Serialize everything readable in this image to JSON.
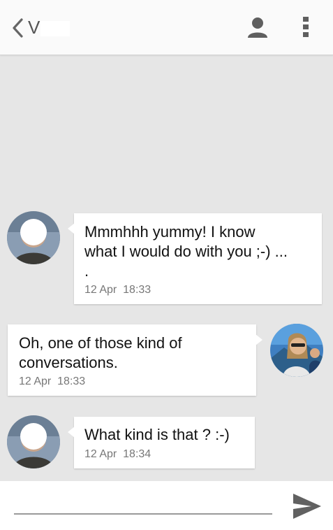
{
  "header": {
    "back_icon": "chevron-left-icon",
    "title": "V",
    "profile_icon": "person-icon",
    "menu_icon": "more-vert-icon"
  },
  "messages": [
    {
      "side": "incoming",
      "text_lines": [
        "Mmmhhh yummy! I know",
        "what I would do with you ;-) ...",
        "."
      ],
      "date": "12 Apr",
      "time": "18:33"
    },
    {
      "side": "outgoing",
      "text_lines": [
        "Oh, one of those kind of",
        "conversations."
      ],
      "date": "12 Apr",
      "time": "18:33"
    },
    {
      "side": "incoming",
      "text_lines": [
        "What kind is that ? :-)"
      ],
      "date": "12 Apr",
      "time": "18:34"
    }
  ],
  "composer": {
    "value": "",
    "placeholder": "",
    "send_icon": "send-icon"
  },
  "colors": {
    "background": "#e6e6e6",
    "app_bar": "#fafafa",
    "bubble": "#ffffff",
    "icon": "#5f5f5f",
    "timestamp": "#777777"
  }
}
